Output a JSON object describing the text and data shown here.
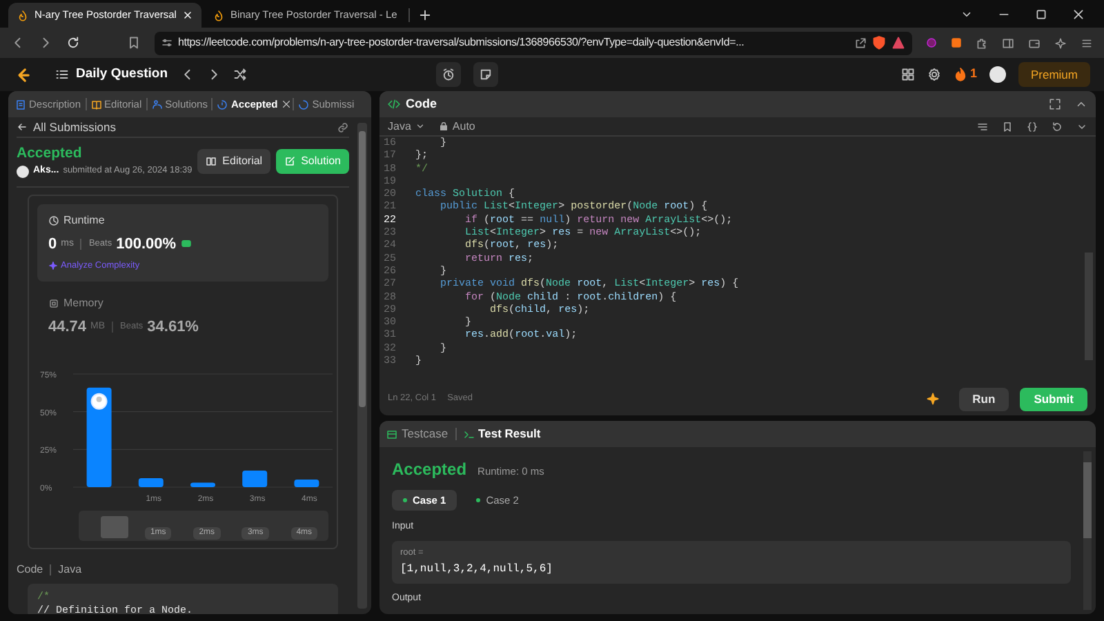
{
  "browser": {
    "tabs": [
      {
        "title": "N-ary Tree Postorder Traversal",
        "selected": true
      },
      {
        "title": "Binary Tree Postorder Traversal - Le",
        "selected": false
      }
    ],
    "address": "https://leetcode.com/problems/n-ary-tree-postorder-traversal/submissions/1368966530/?envType=daily-question&envId=..."
  },
  "nav": {
    "title": "Daily Question",
    "streak": "1",
    "premium": "Premium"
  },
  "left_panel": {
    "tabs": [
      {
        "label": "Description",
        "selected": false,
        "closable": false
      },
      {
        "label": "Editorial",
        "selected": false,
        "closable": false
      },
      {
        "label": "Solutions",
        "selected": false,
        "closable": false
      },
      {
        "label": "Accepted",
        "selected": true,
        "closable": true
      },
      {
        "label": "Submissi",
        "selected": false,
        "closable": false
      }
    ],
    "back_link": "All Submissions",
    "status": "Accepted",
    "user": "Aks...",
    "submitted": "submitted at Aug 26, 2024 18:39",
    "buttons": [
      {
        "label": "Editorial",
        "kind": "secondary"
      },
      {
        "label": "Solution",
        "kind": "primary"
      }
    ],
    "metrics": [
      {
        "title": "Runtime",
        "value": "0",
        "unit": "ms",
        "beats_label": "Beats",
        "beats": "100.00%",
        "selected": true,
        "link": "Analyze Complexity"
      },
      {
        "title": "Memory",
        "value": "44.74",
        "unit": "MB",
        "beats_label": "Beats",
        "beats": "34.61%",
        "selected": false
      }
    ],
    "chart_data": {
      "type": "bar",
      "categories": [
        null,
        "1ms",
        "2ms",
        "3ms",
        "4ms"
      ],
      "values": [
        66,
        6,
        3,
        11,
        5
      ],
      "ylim": [
        0,
        75
      ],
      "yticks": [
        {
          "value": 0,
          "label": "0%"
        },
        {
          "value": 25,
          "label": "25%"
        },
        {
          "value": 50,
          "label": "50%"
        },
        {
          "value": 75,
          "label": "75%"
        }
      ]
    },
    "range_labels": [
      "1ms",
      "2ms",
      "3ms",
      "4ms"
    ],
    "code_label": "Code",
    "language": "Java",
    "code_preview": [
      "/*",
      "// Definition for a Node."
    ]
  },
  "editor": {
    "title": "Code",
    "language": "Java",
    "mode": "Auto",
    "lines": [
      {
        "number": "16",
        "current": false,
        "tokens": [
          {
            "kind": "plain",
            "text": "    }"
          }
        ]
      },
      {
        "number": "17",
        "current": false,
        "tokens": [
          {
            "kind": "plain",
            "text": "};"
          }
        ]
      },
      {
        "number": "18",
        "current": false,
        "tokens": [
          {
            "kind": "comment",
            "text": "*/"
          }
        ]
      },
      {
        "number": "19",
        "current": false
      },
      {
        "number": "20",
        "current": false,
        "tokens": [
          {
            "kind": "keyword",
            "text": "class "
          },
          {
            "kind": "type",
            "text": "Solution"
          },
          {
            "kind": "plain",
            "text": " {"
          }
        ]
      },
      {
        "number": "21",
        "current": false,
        "tokens": [
          {
            "kind": "keyword",
            "text": "    public "
          },
          {
            "kind": "type",
            "text": "List"
          },
          {
            "kind": "plain",
            "text": "<"
          },
          {
            "kind": "type",
            "text": "Integer"
          },
          {
            "kind": "plain",
            "text": "> "
          },
          {
            "kind": "function",
            "text": "postorder"
          },
          {
            "kind": "plain",
            "text": "("
          },
          {
            "kind": "type",
            "text": "Node"
          },
          {
            "kind": "var",
            "text": " root"
          },
          {
            "kind": "plain",
            "text": ") {"
          }
        ]
      },
      {
        "number": "22",
        "current": true,
        "tokens": [
          {
            "kind": "control",
            "text": "        if "
          },
          {
            "kind": "plain",
            "text": "("
          },
          {
            "kind": "var",
            "text": "root"
          },
          {
            "kind": "plain",
            "text": " == "
          },
          {
            "kind": "keyword",
            "text": "null"
          },
          {
            "kind": "plain",
            "text": ") "
          },
          {
            "kind": "control",
            "text": "return new "
          },
          {
            "kind": "type",
            "text": "ArrayList"
          },
          {
            "kind": "plain",
            "text": "<>();"
          }
        ]
      },
      {
        "number": "23",
        "current": false,
        "tokens": [
          {
            "kind": "type",
            "text": "        List"
          },
          {
            "kind": "plain",
            "text": "<"
          },
          {
            "kind": "type",
            "text": "Integer"
          },
          {
            "kind": "plain",
            "text": "> "
          },
          {
            "kind": "var",
            "text": "res"
          },
          {
            "kind": "plain",
            "text": " = "
          },
          {
            "kind": "control",
            "text": "new "
          },
          {
            "kind": "type",
            "text": "ArrayList"
          },
          {
            "kind": "plain",
            "text": "<>();"
          }
        ]
      },
      {
        "number": "24",
        "current": false,
        "tokens": [
          {
            "kind": "function",
            "text": "        dfs"
          },
          {
            "kind": "plain",
            "text": "("
          },
          {
            "kind": "var",
            "text": "root"
          },
          {
            "kind": "plain",
            "text": ", "
          },
          {
            "kind": "var",
            "text": "res"
          },
          {
            "kind": "plain",
            "text": ");"
          }
        ]
      },
      {
        "number": "25",
        "current": false,
        "tokens": [
          {
            "kind": "control",
            "text": "        return "
          },
          {
            "kind": "var",
            "text": "res"
          },
          {
            "kind": "plain",
            "text": ";"
          }
        ]
      },
      {
        "number": "26",
        "current": false,
        "tokens": [
          {
            "kind": "plain",
            "text": "    }"
          }
        ]
      },
      {
        "number": "27",
        "current": false,
        "tokens": [
          {
            "kind": "keyword",
            "text": "    private void "
          },
          {
            "kind": "function",
            "text": "dfs"
          },
          {
            "kind": "plain",
            "text": "("
          },
          {
            "kind": "type",
            "text": "Node"
          },
          {
            "kind": "var",
            "text": " root"
          },
          {
            "kind": "plain",
            "text": ", "
          },
          {
            "kind": "type",
            "text": "List"
          },
          {
            "kind": "plain",
            "text": "<"
          },
          {
            "kind": "type",
            "text": "Integer"
          },
          {
            "kind": "plain",
            "text": "> "
          },
          {
            "kind": "var",
            "text": "res"
          },
          {
            "kind": "plain",
            "text": ") {"
          }
        ]
      },
      {
        "number": "28",
        "current": false,
        "tokens": [
          {
            "kind": "control",
            "text": "        for "
          },
          {
            "kind": "plain",
            "text": "("
          },
          {
            "kind": "type",
            "text": "Node"
          },
          {
            "kind": "var",
            "text": " child"
          },
          {
            "kind": "plain",
            "text": " : "
          },
          {
            "kind": "var",
            "text": "root"
          },
          {
            "kind": "plain",
            "text": "."
          },
          {
            "kind": "var",
            "text": "children"
          },
          {
            "kind": "plain",
            "text": ") {"
          }
        ]
      },
      {
        "number": "29",
        "current": false,
        "tokens": [
          {
            "kind": "function",
            "text": "            dfs"
          },
          {
            "kind": "plain",
            "text": "("
          },
          {
            "kind": "var",
            "text": "child"
          },
          {
            "kind": "plain",
            "text": ", "
          },
          {
            "kind": "var",
            "text": "res"
          },
          {
            "kind": "plain",
            "text": ");"
          }
        ]
      },
      {
        "number": "30",
        "current": false,
        "tokens": [
          {
            "kind": "plain",
            "text": "        }"
          }
        ]
      },
      {
        "number": "31",
        "current": false,
        "tokens": [
          {
            "kind": "var",
            "text": "        res"
          },
          {
            "kind": "plain",
            "text": "."
          },
          {
            "kind": "function",
            "text": "add"
          },
          {
            "kind": "plain",
            "text": "("
          },
          {
            "kind": "var",
            "text": "root"
          },
          {
            "kind": "plain",
            "text": "."
          },
          {
            "kind": "var",
            "text": "val"
          },
          {
            "kind": "plain",
            "text": ");"
          }
        ]
      },
      {
        "number": "32",
        "current": false,
        "tokens": [
          {
            "kind": "plain",
            "text": "    }"
          }
        ]
      },
      {
        "number": "33",
        "current": false,
        "tokens": [
          {
            "kind": "plain",
            "text": "}"
          }
        ]
      }
    ],
    "cursor": "Ln 22, Col 1",
    "save_state": "Saved",
    "buttons": [
      {
        "label": "Run",
        "kind": "secondary"
      },
      {
        "label": "Submit",
        "kind": "primary"
      }
    ]
  },
  "result_panel": {
    "tabs": [
      {
        "label": "Testcase",
        "selected": false
      },
      {
        "label": "Test Result",
        "selected": true
      }
    ],
    "status": "Accepted",
    "runtime": "Runtime: 0 ms",
    "cases": [
      {
        "label": "Case 1",
        "selected": true
      },
      {
        "label": "Case 2",
        "selected": false
      }
    ],
    "input_label": "Input",
    "param": "root =",
    "param_value": "[1,null,3,2,4,null,5,6]",
    "output_label": "Output"
  }
}
